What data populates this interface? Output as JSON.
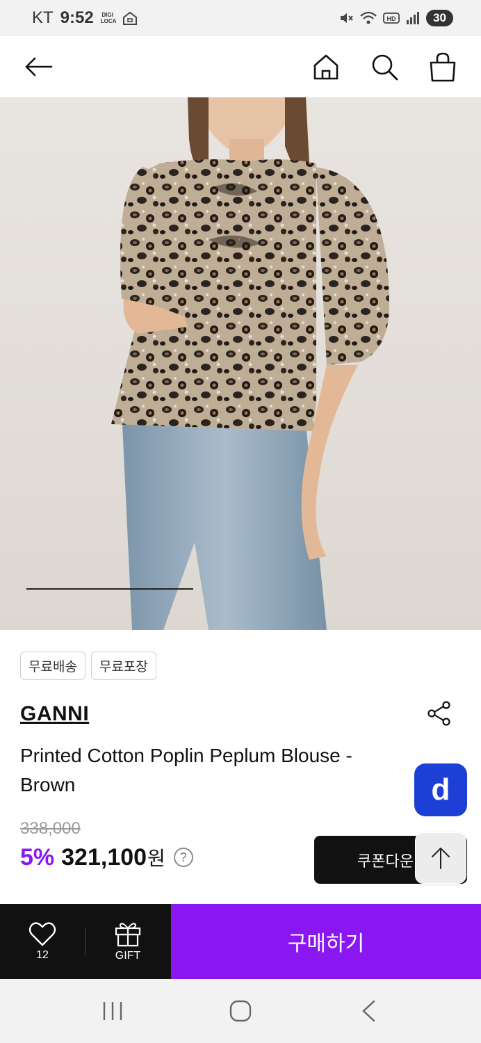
{
  "status_bar": {
    "carrier": "KT",
    "time": "9:52",
    "badge": "DIGI LOCA",
    "battery": "30"
  },
  "header": {
    "back_icon": "arrow-left-icon",
    "home_icon": "home-icon",
    "search_icon": "search-icon",
    "cart_icon": "shopping-bag-icon"
  },
  "hero": {
    "image_progress": 0.35
  },
  "tags": [
    "무료배송",
    "무료포장"
  ],
  "product": {
    "brand": "GANNI",
    "name": "Printed Cotton Poplin Peplum Blouse - Brown",
    "original_price": "338,000",
    "discount": "5%",
    "price": "321,100",
    "currency": "원",
    "help": "?"
  },
  "coupon_button": "쿠폰다운",
  "fabs": {
    "d_label": "d",
    "top_icon": "arrow-up-icon"
  },
  "action_bar": {
    "like_count": "12",
    "gift_label": "GIFT",
    "buy_label": "구매하기"
  },
  "colors": {
    "accent": "#8a17f2",
    "dark": "#111111",
    "d_blue": "#1e3fd6"
  }
}
